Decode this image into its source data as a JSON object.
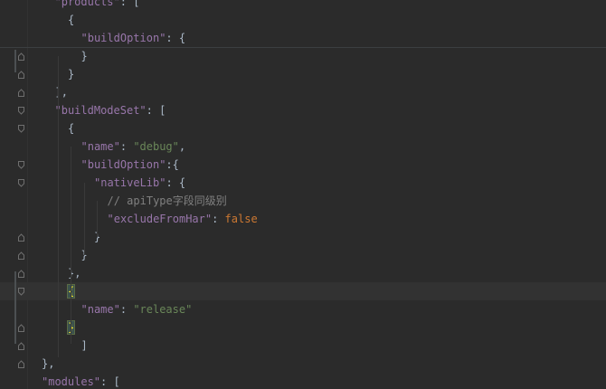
{
  "editor": {
    "lines": [
      {
        "indent": "  ",
        "tokens": [
          {
            "t": "key",
            "v": "\"products\""
          },
          {
            "t": "punc",
            "v": ": ["
          }
        ]
      },
      {
        "indent": "    ",
        "tokens": [
          {
            "t": "punc",
            "v": "{"
          }
        ]
      },
      {
        "indent": "      ",
        "tokens": [
          {
            "t": "key",
            "v": "\"buildOption\""
          },
          {
            "t": "punc",
            "v": ": {"
          }
        ]
      },
      {
        "indent": "      ",
        "tokens": [
          {
            "t": "punc",
            "v": "}"
          }
        ]
      },
      {
        "indent": "    ",
        "tokens": [
          {
            "t": "punc",
            "v": "}"
          }
        ]
      },
      {
        "indent": "  ",
        "tokens": [
          {
            "t": "punc",
            "v": "],"
          }
        ]
      },
      {
        "indent": "  ",
        "tokens": [
          {
            "t": "key",
            "v": "\"buildModeSet\""
          },
          {
            "t": "punc",
            "v": ": ["
          }
        ]
      },
      {
        "indent": "    ",
        "tokens": [
          {
            "t": "punc",
            "v": "{"
          }
        ]
      },
      {
        "indent": "      ",
        "tokens": [
          {
            "t": "key",
            "v": "\"name\""
          },
          {
            "t": "punc",
            "v": ": "
          },
          {
            "t": "str",
            "v": "\"debug\""
          },
          {
            "t": "punc",
            "v": ","
          }
        ]
      },
      {
        "indent": "      ",
        "tokens": [
          {
            "t": "key",
            "v": "\"buildOption\""
          },
          {
            "t": "punc",
            "v": ":{"
          }
        ]
      },
      {
        "indent": "        ",
        "tokens": [
          {
            "t": "key",
            "v": "\"nativeLib\""
          },
          {
            "t": "punc",
            "v": ": {"
          }
        ]
      },
      {
        "indent": "          ",
        "tokens": [
          {
            "t": "comment",
            "v": "// apiType"
          },
          {
            "t": "commentcjk",
            "v": "字段同级别"
          }
        ]
      },
      {
        "indent": "          ",
        "tokens": [
          {
            "t": "key",
            "v": "\"excludeFromHar\""
          },
          {
            "t": "punc",
            "v": ": "
          },
          {
            "t": "kw",
            "v": "false"
          }
        ]
      },
      {
        "indent": "        ",
        "tokens": [
          {
            "t": "punc",
            "v": "}"
          }
        ]
      },
      {
        "indent": "      ",
        "tokens": [
          {
            "t": "punc",
            "v": "}"
          }
        ]
      },
      {
        "indent": "    ",
        "tokens": [
          {
            "t": "punc",
            "v": "},"
          }
        ]
      },
      {
        "indent": "    ",
        "tokens": [
          {
            "t": "brace",
            "v": "{"
          }
        ],
        "current": true
      },
      {
        "indent": "      ",
        "tokens": [
          {
            "t": "key",
            "v": "\"name\""
          },
          {
            "t": "punc",
            "v": ": "
          },
          {
            "t": "str",
            "v": "\"release\""
          }
        ]
      },
      {
        "indent": "    ",
        "tokens": [
          {
            "t": "brace",
            "v": "}"
          }
        ]
      },
      {
        "indent": "      ",
        "tokens": [
          {
            "t": "punc",
            "v": "]"
          }
        ]
      },
      {
        "indent": "",
        "tokens": [
          {
            "t": "punc",
            "v": "},"
          }
        ]
      },
      {
        "indent": "",
        "tokens": [
          {
            "t": "key",
            "v": "\"modules\""
          },
          {
            "t": "punc",
            "v": ": ["
          }
        ]
      }
    ]
  },
  "colors": {
    "background": "#2b2b2b",
    "key": "#9876aa",
    "string": "#6a8759",
    "keyword": "#cc7832",
    "comment": "#808080",
    "punctuation": "#a9b7c6",
    "brace_match": "#ffef28"
  }
}
